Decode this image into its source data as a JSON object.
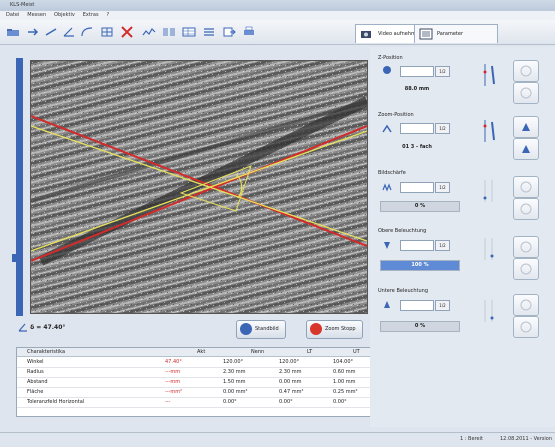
{
  "window": {
    "title": "KLS-Meist"
  },
  "menu": {
    "items": [
      "Datei",
      "Messen",
      "Objektiv",
      "Extras",
      "?"
    ]
  },
  "tabs": [
    {
      "label": "Video aufnehmen",
      "active": true
    },
    {
      "label": "Parameter"
    }
  ],
  "viewer": {
    "angle_readout": "δ = 47.40°"
  },
  "buttons": {
    "standbild": "Standbild",
    "stop": "Zoom Stopp"
  },
  "table": {
    "headers": [
      "Charakteristika",
      "Akt",
      "Nenn",
      "LT",
      "UT"
    ],
    "rows": [
      {
        "name": "Winkel",
        "akt": "47.40°",
        "nenn": "120.00°",
        "lt": "120.00°",
        "ut": "104.00°"
      },
      {
        "name": "Radius",
        "akt": "---mm",
        "nenn": "2.30 mm",
        "lt": "2.30 mm",
        "ut": "0.60 mm"
      },
      {
        "name": "Abstand",
        "akt": "---mm",
        "nenn": "1.50 mm",
        "lt": "0.00 mm",
        "ut": "1.00 mm"
      },
      {
        "name": "Fläche",
        "akt": "---mm²",
        "nenn": "0.00 mm²",
        "lt": "0.47 mm²",
        "ut": "0.25 mm²"
      },
      {
        "name": "Toleranzfeld Horizontal",
        "akt": "---",
        "nenn": "0.00°",
        "lt": "0.00°",
        "ut": "0.00°"
      }
    ]
  },
  "sections": {
    "z_position": {
      "title": "Z-Position",
      "unit": "1/2",
      "readout": "88.0 mm"
    },
    "zoom_position": {
      "title": "Zoom-Position",
      "unit": "1/2",
      "readout": "01 3 - fach"
    },
    "bildschärfe": {
      "title": "Bildschärfe",
      "unit": "1/2",
      "bar_label": "0 %",
      "bar_fill": 0.0
    },
    "obere_beleuchtung": {
      "title": "Obere Beleuchtung",
      "unit": "1/2",
      "bar_label": "100 %",
      "bar_fill": 1.0
    },
    "untere_beleuchtung": {
      "title": "Untere Beleuchtung",
      "unit": "1/2",
      "bar_label": "0 %",
      "bar_fill": 0.0
    }
  },
  "status": {
    "left": "1 : Bereit",
    "right": "12.08.2011 - Version"
  },
  "colors": {
    "accent": "#3b66b6",
    "red_line": "#d22b2b",
    "yellow_line": "#e7e15a",
    "stop_red": "#d8362a"
  }
}
